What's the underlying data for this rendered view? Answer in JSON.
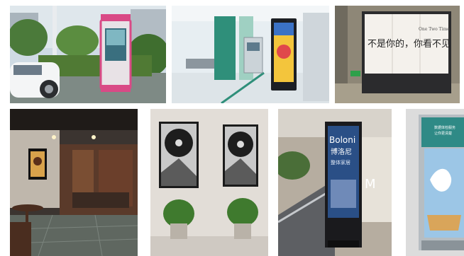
{
  "tiles": {
    "videowall": {
      "sign_text": "不是你的，你看不见",
      "sign_small": "One Two Time"
    },
    "mall_kiosk": {
      "brand": "Boloni",
      "brand_cn": "博洛尼",
      "sub_cn": "整体家居",
      "m_letter": "M"
    },
    "cut_kiosk": {
      "top_cn": "数据体检服务",
      "top_cn_2": "让你更清楚"
    }
  }
}
